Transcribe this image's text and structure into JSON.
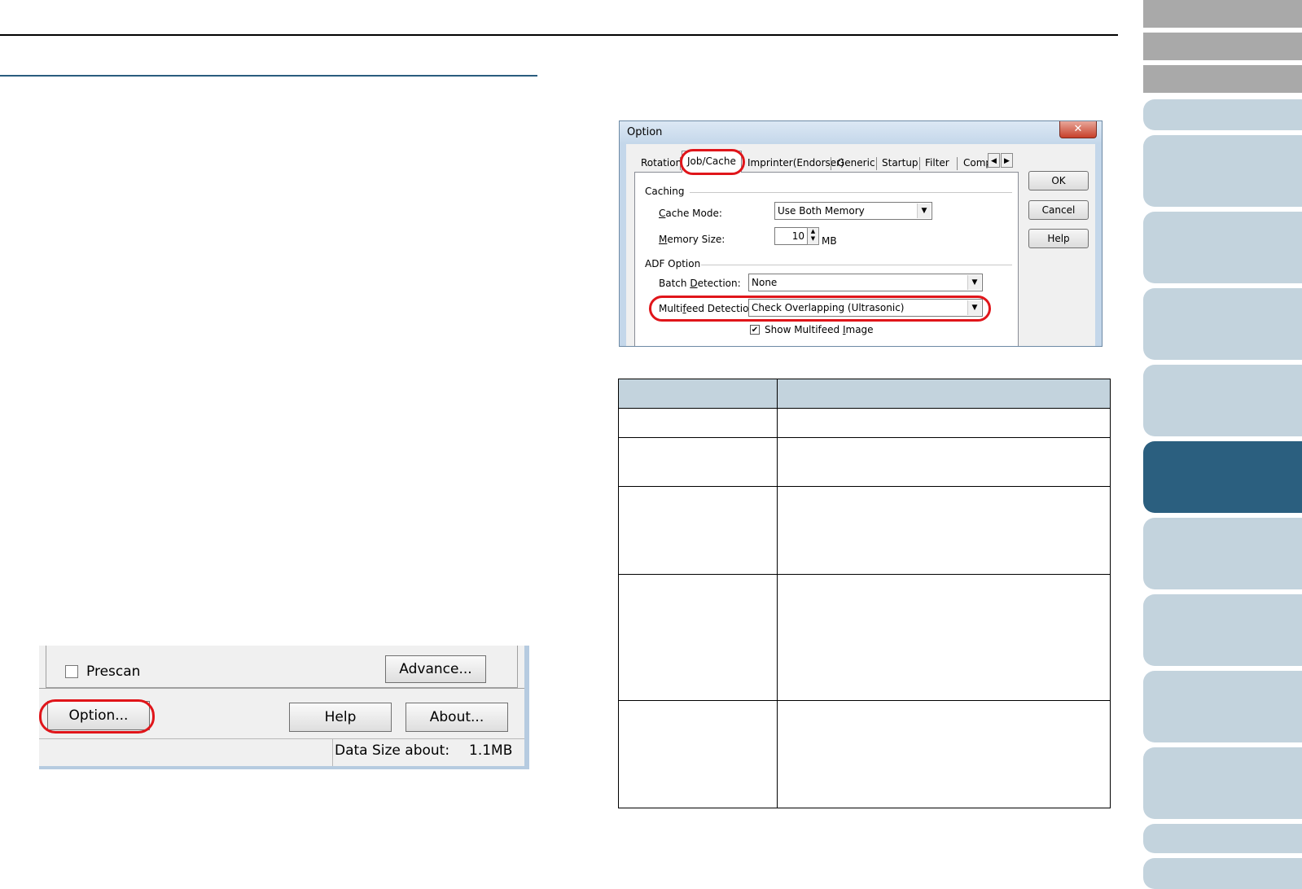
{
  "option_dialog": {
    "title": "Option",
    "close_glyph": "✕",
    "tabs": [
      "Rotation",
      "Job/Cache",
      "Imprinter(Endorser)",
      "Generic",
      "Startup",
      "Filter",
      "Comp"
    ],
    "tab_scroll_left": "◀",
    "tab_scroll_right": "▶",
    "buttons": {
      "ok": "OK",
      "cancel": "Cancel",
      "help": "Help"
    },
    "caching": {
      "group_label": "Caching",
      "cache_mode_label_u": "C",
      "cache_mode_label_rest": "ache Mode:",
      "cache_mode_value": "Use Both Memory",
      "memory_size_label_u": "M",
      "memory_size_label_rest": "emory Size:",
      "memory_size_value": "10",
      "memory_size_unit": "MB"
    },
    "adf_option": {
      "group_label": "ADF Option",
      "batch_detection_label_a": "Batch ",
      "batch_detection_label_u": "D",
      "batch_detection_label_b": "etection:",
      "batch_detection_value": "None",
      "multifeed_label_a": "Multi",
      "multifeed_label_u": "f",
      "multifeed_label_b": "eed Detection:",
      "multifeed_value": "Check Overlapping (Ultrasonic)",
      "show_multifeed_label_a": "Show Multifeed ",
      "show_multifeed_label_u": "I",
      "show_multifeed_label_b": "mage",
      "show_multifeed_checked": true
    }
  },
  "scan_dialog_fragment": {
    "prescan_label": "Prescan",
    "advance_button": "Advance...",
    "option_button": "Option...",
    "help_button": "Help",
    "about_button": "About...",
    "data_size_label": "Data Size about:",
    "data_size_value": "1.1MB"
  },
  "colors": {
    "highlight_circle": "#e0151a",
    "sidebar_tab": "#c3d3dd",
    "sidebar_active": "#2b5f7f",
    "table_header": "#c3d3dd"
  }
}
